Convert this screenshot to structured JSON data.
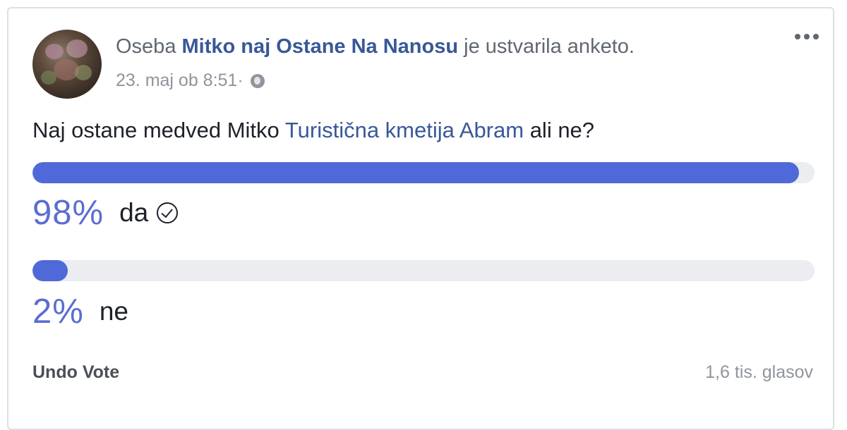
{
  "post": {
    "header_prefix": "Oseba ",
    "author": "Mitko naj Ostane Na Nanosu",
    "header_suffix": " je ustvarila anketo.",
    "timestamp": "23. maj ob 8:51",
    "separator": " · ",
    "privacy_icon": "globe-icon",
    "more_icon": "more-options-icon"
  },
  "poll": {
    "question_prefix": "Naj ostane medved Mitko ",
    "question_tag": "Turistična kmetija Abram",
    "question_suffix": " ali ne?",
    "options": [
      {
        "percent_label": "98%",
        "label": "da",
        "fill": 0.98,
        "selected": true
      },
      {
        "percent_label": "2%",
        "label": "ne",
        "fill": 0.045,
        "selected": false
      }
    ],
    "undo_label": "Undo Vote",
    "votes_label": "1,6 tis. glasov"
  },
  "colors": {
    "bar_fill": "#4f6ad8",
    "bar_track": "#ebedf0",
    "link": "#385898",
    "percent": "#5a6ed0"
  }
}
